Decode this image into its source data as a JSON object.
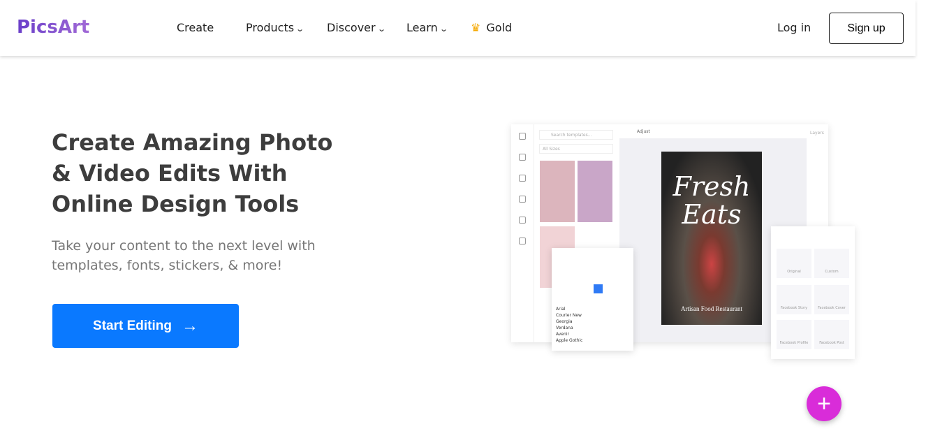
{
  "nav": {
    "logo": "PicsArt",
    "items": [
      {
        "label": "Create"
      },
      {
        "label": "Products",
        "chevron": "chevron-down-icon"
      },
      {
        "label": "Discover",
        "chevron": "chevron-down-icon"
      },
      {
        "label": "Learn",
        "chevron": "chevron-down-icon"
      },
      {
        "label": "Gold",
        "icon": "crown-icon"
      }
    ],
    "login": "Log in",
    "signup": "Sign up"
  },
  "hero": {
    "title": "Create Amazing Photo & Video Edits With Online Design Tools",
    "subtitle": "Take your content to the next level with templates, fonts, stickers, & more!",
    "cta": "Start Editing",
    "cta_icon": "arrow-right-icon"
  },
  "editor_preview": {
    "search_placeholder": "Search templates...",
    "size_filter": "All Sizes",
    "header": "Adjust",
    "layers": "Layers",
    "poster_title": "Fresh Eats",
    "poster_subtitle": "Artisan Food Restaurant",
    "fonts": [
      "Arial",
      "Courier New",
      "Georgia",
      "Verdana",
      "Avenir",
      "Apple Gothic"
    ],
    "sizes": [
      "Original",
      "Custom",
      "Facebook Story",
      "Facebook Cover",
      "Facebook Profile",
      "Facebook Post"
    ]
  },
  "fab": {
    "icon": "plus-icon"
  },
  "colors": {
    "accent": "#0a79ff",
    "fab": "#d92cd9",
    "gold": "#f5a800"
  }
}
